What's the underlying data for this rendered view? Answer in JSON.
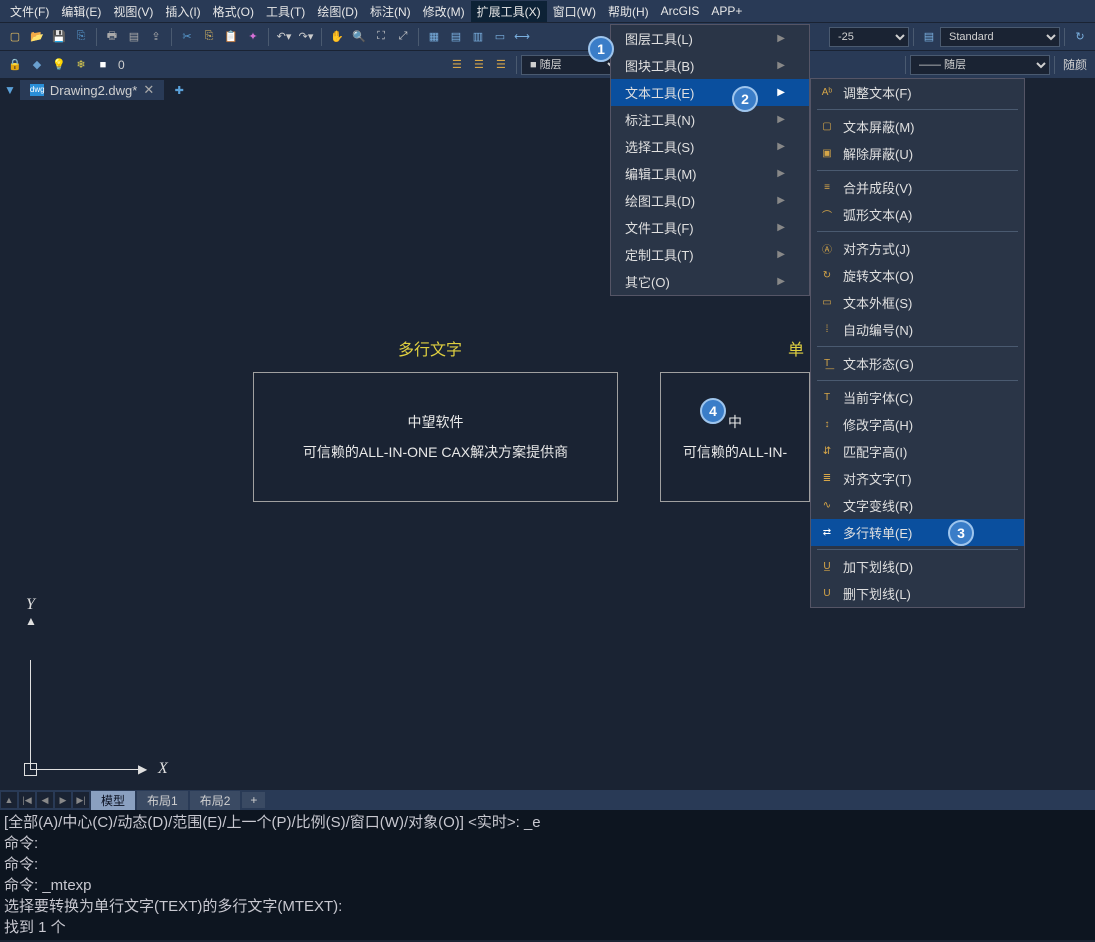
{
  "menu": {
    "file": "文件(F)",
    "edit": "编辑(E)",
    "view": "视图(V)",
    "insert": "插入(I)",
    "format": "格式(O)",
    "tools": "工具(T)",
    "draw": "绘图(D)",
    "dim": "标注(N)",
    "modify": "修改(M)",
    "express": "扩展工具(X)",
    "window": "窗口(W)",
    "help": "帮助(H)",
    "arcgis": "ArcGIS",
    "app": "APP+"
  },
  "combo": {
    "style_right": "-25",
    "standard": "Standard",
    "sui_ceng": "随层",
    "sui_ceng2": "随层",
    "sui_yan": "随颜"
  },
  "file_tab": {
    "name": "Drawing2.dwg*",
    "close": "✕"
  },
  "canvas": {
    "left_label": "多行文字",
    "right_label": "单",
    "box1_line1": "中望软件",
    "box1_line2": "可信赖的ALL-IN-ONE CAX解决方案提供商",
    "box2_line1": "中",
    "box2_line2": "可信赖的ALL-IN-",
    "axis_x": "X",
    "axis_y": "Y"
  },
  "drop": {
    "layer": "图层工具(L)",
    "block": "图块工具(B)",
    "text": "文本工具(E)",
    "dim": "标注工具(N)",
    "select": "选择工具(S)",
    "edit": "编辑工具(M)",
    "draw": "绘图工具(D)",
    "file": "文件工具(F)",
    "custom": "定制工具(T)",
    "other": "其它(O)"
  },
  "sub": {
    "adjust": "调整文本(F)",
    "mask": "文本屏蔽(M)",
    "unmask": "解除屏蔽(U)",
    "merge": "合并成段(V)",
    "arc": "弧形文本(A)",
    "justify": "对齐方式(J)",
    "rotate": "旋转文本(O)",
    "frame": "文本外框(S)",
    "autonum": "自动编号(N)",
    "form": "文本形态(G)",
    "curfont": "当前字体(C)",
    "modheight": "修改字高(H)",
    "matchheight": "匹配字高(I)",
    "aligntext": "对齐文字(T)",
    "curve": "文字变线(R)",
    "m2s": "多行转单(E)",
    "addunder": "加下划线(D)",
    "delunder": "删下划线(L)"
  },
  "badges": {
    "b1": "1",
    "b2": "2",
    "b3": "3",
    "b4": "4"
  },
  "layout_tabs": {
    "model": "模型",
    "l1": "布局1",
    "l2": "布局2",
    "plus": "+"
  },
  "cmd": {
    "l1": "[全部(A)/中心(C)/动态(D)/范围(E)/上一个(P)/比例(S)/窗口(W)/对象(O)] <实时>: _e",
    "l2": "命令:",
    "l3": "命令:",
    "l4": "命令: _mtexp",
    "l5": "选择要转换为单行文字(TEXT)的多行文字(MTEXT):",
    "l6": "找到 1 个"
  },
  "toolbar_row2_label": "0"
}
